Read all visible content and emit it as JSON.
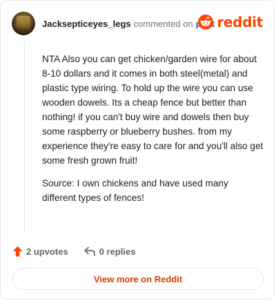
{
  "header": {
    "username": "Jacksepticeyes_legs",
    "commented_text": "commented on",
    "post_link": "post",
    "brand": "reddit"
  },
  "comment": {
    "paragraphs": [
      "NTA Also you can get chicken/garden wire for about 8-10 dollars and it comes in both steel(metal) and plastic type wiring. To hold up the wire you can use wooden dowels. Its a cheap fence but better than nothing! if you can't buy wire and dowels then buy some raspberry or blueberry bushes. from my experience they're easy to care for and you'll also get some fresh grown fruit!",
      "Source: I own chickens and have used many different types of fences!"
    ]
  },
  "actions": {
    "upvotes": "2 upvotes",
    "replies": "0 replies"
  },
  "footer": {
    "view_more": "View more on Reddit"
  },
  "colors": {
    "brand": "#ff4500",
    "link": "#0a6bb8",
    "view_more": "#d93a00"
  },
  "icons": {
    "upvote": "upvote-arrow-icon",
    "reply": "reply-arrow-icon",
    "brand": "reddit-snoo-icon"
  }
}
